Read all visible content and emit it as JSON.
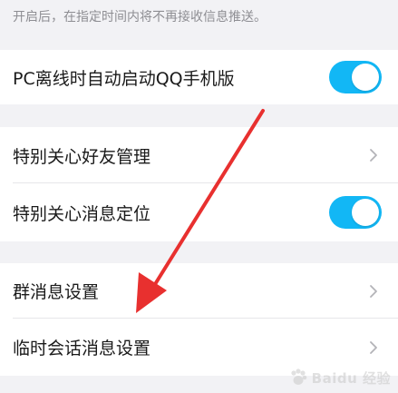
{
  "hint_text": "开启后，在指定时间内将不再接收信息推送。",
  "rows": [
    {
      "label": "PC离线时自动启动QQ手机版",
      "control": "toggle",
      "on": true
    },
    {
      "label": "特别关心好友管理",
      "control": "chevron"
    },
    {
      "label": "特别关心消息定位",
      "control": "toggle",
      "on": true
    },
    {
      "label": "群消息设置",
      "control": "chevron"
    },
    {
      "label": "临时会话消息设置",
      "control": "chevron"
    }
  ],
  "colors": {
    "toggle_on": "#12b7f5",
    "arrow": "#e8302f",
    "background": "#f2f2f5"
  },
  "watermark": {
    "text": "Baidu 经验"
  }
}
